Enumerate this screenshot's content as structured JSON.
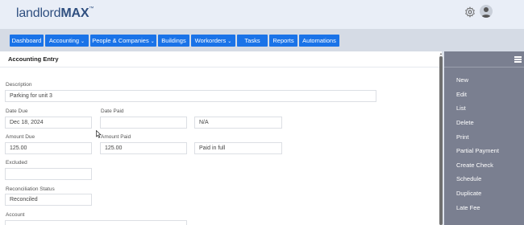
{
  "header": {
    "logo_light": "landlord",
    "logo_bold": "MAX",
    "logo_tm": "™",
    "icons": [
      "gear-icon",
      "user-icon"
    ]
  },
  "nav": [
    {
      "label": "Dashboard",
      "dropdown": false
    },
    {
      "label": "Accounting",
      "dropdown": true
    },
    {
      "label": "People & Companies",
      "dropdown": true
    },
    {
      "label": "Buildings",
      "dropdown": false
    },
    {
      "label": "Workorders",
      "dropdown": true
    },
    {
      "label": "Tasks",
      "dropdown": false
    },
    {
      "label": "Reports",
      "dropdown": false
    },
    {
      "label": "Automations",
      "dropdown": false
    }
  ],
  "form": {
    "title": "Accounting Entry",
    "description_label": "Description",
    "description_value": "Parking for unit 3",
    "date_due_label": "Date Due",
    "date_due_value": "Dec 18, 2024",
    "date_paid_label": "Date Paid",
    "date_paid_value": "",
    "date_paid_status": "N/A",
    "amount_due_label": "Amount Due",
    "amount_due_value": "125.00",
    "amount_paid_label": "Amount Paid",
    "amount_paid_value": "125.00",
    "paid_status": "Paid in full",
    "excluded_label": "Excluded",
    "excluded_value": "",
    "reconciliation_label": "Reconciliation Status",
    "reconciliation_value": "Reconciled",
    "account_label": "Account"
  },
  "sidebar": {
    "items": [
      "New",
      "Edit",
      "List",
      "Delete",
      "Print",
      "Partial Payment",
      "Create Check",
      "Schedule",
      "Duplicate",
      "Late Fee"
    ]
  },
  "colors": {
    "nav_blue": "#1a73e8",
    "sidebar_bg": "#7a7f90",
    "logo_color": "#2f4f80"
  }
}
